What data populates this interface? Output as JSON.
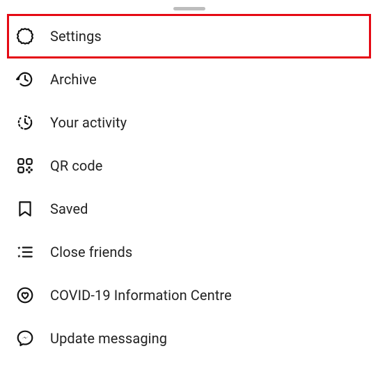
{
  "menu": {
    "items": [
      {
        "label": "Settings"
      },
      {
        "label": "Archive"
      },
      {
        "label": "Your activity"
      },
      {
        "label": "QR code"
      },
      {
        "label": "Saved"
      },
      {
        "label": "Close friends"
      },
      {
        "label": "COVID-19 Information Centre"
      },
      {
        "label": "Update messaging"
      }
    ]
  }
}
